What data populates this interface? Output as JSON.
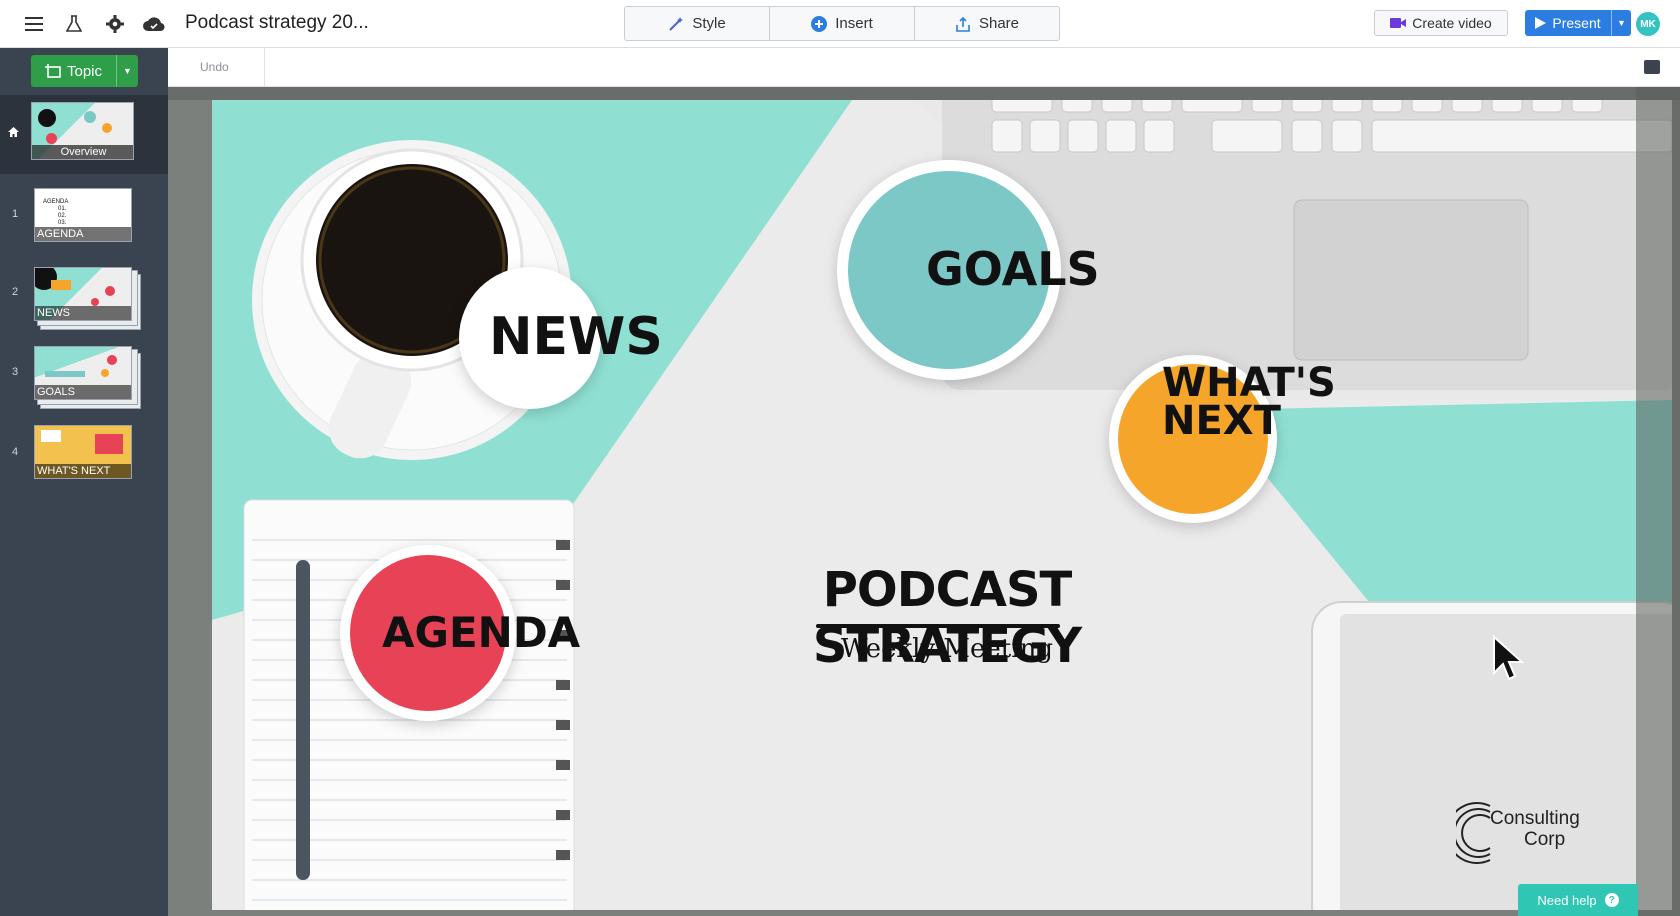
{
  "topbar": {
    "doc_title": "Podcast strategy 20...",
    "tabs": [
      {
        "label": "Style",
        "icon": "magic-wand-icon"
      },
      {
        "label": "Insert",
        "icon": "plus-circle-icon"
      },
      {
        "label": "Share",
        "icon": "share-upload-icon"
      }
    ],
    "create_video_label": "Create video",
    "present_label": "Present",
    "avatar_initials": "MK"
  },
  "sidebar": {
    "topic_label": "Topic",
    "overview_label": "Overview",
    "slides": [
      {
        "num": "1",
        "label": "AGENDA"
      },
      {
        "num": "2",
        "label": "NEWS"
      },
      {
        "num": "3",
        "label": "GOALS"
      },
      {
        "num": "4",
        "label": "WHAT'S NEXT"
      }
    ]
  },
  "toolbar": {
    "undo_label": "Undo"
  },
  "slide": {
    "title": "PODCAST STRATEGY",
    "subtitle": "Weekly Meeting",
    "circles": {
      "news": "NEWS",
      "goals": "GOALS",
      "whats_next_line1": "WHAT'S",
      "whats_next_line2": "NEXT",
      "agenda": "AGENDA"
    },
    "logo_line1": "Consulting",
    "logo_line2": "Corp",
    "colors": {
      "teal": "#7cc8c7",
      "orange": "#f5a62a",
      "red": "#e84256",
      "mint_bg": "#8fe0d3"
    }
  },
  "help": {
    "label": "Need help"
  }
}
